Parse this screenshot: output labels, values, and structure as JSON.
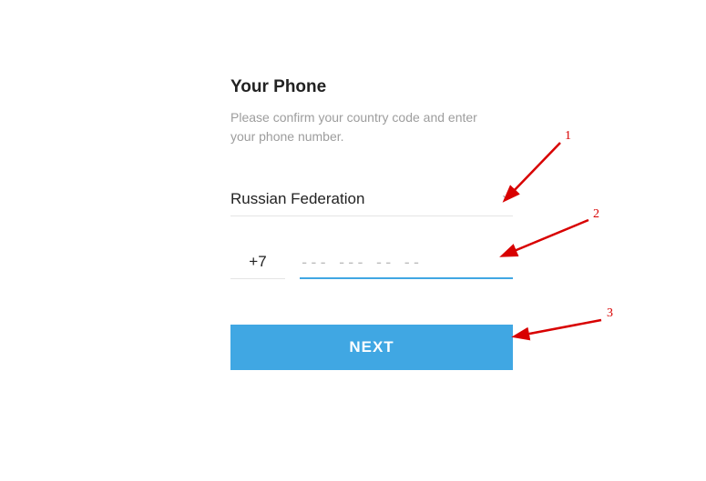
{
  "title": "Your Phone",
  "subtitle": "Please confirm your country code and enter your phone number.",
  "country": {
    "label": "Russian Federation"
  },
  "phone": {
    "code": "+7",
    "placeholder": "--- --- -- --",
    "value": ""
  },
  "next_label": "NEXT",
  "annotations": {
    "a1": "1",
    "a2": "2",
    "a3": "3"
  },
  "colors": {
    "accent": "#40a7e3",
    "annotation": "#d80000"
  }
}
